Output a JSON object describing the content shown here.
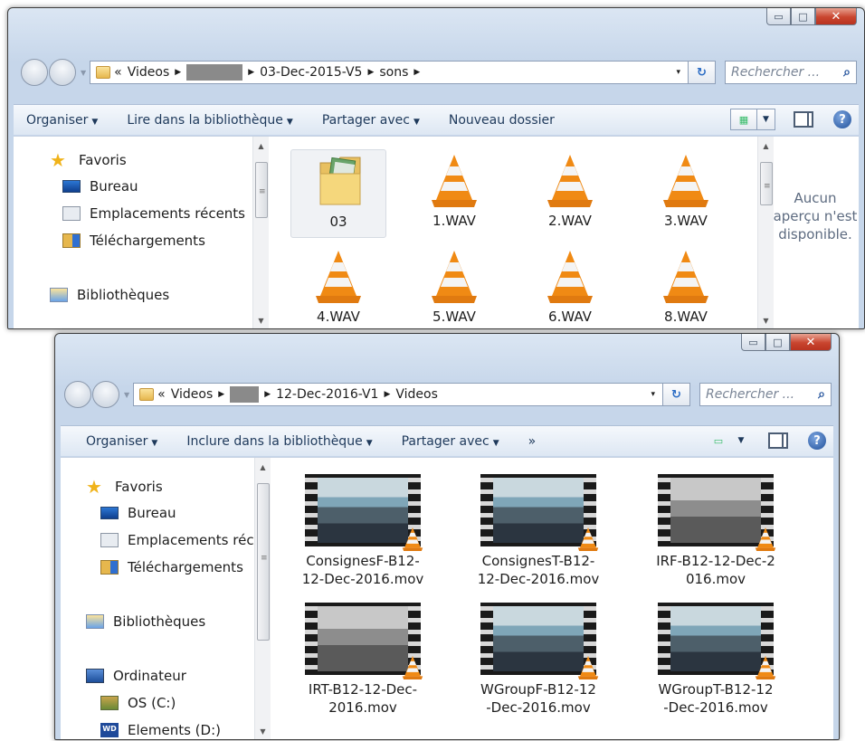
{
  "window1": {
    "caption": {
      "minimize": "▭",
      "maximize": "□",
      "close": "✕"
    },
    "address": {
      "chevron": "«",
      "segments": [
        "Videos",
        "03-Dec-2015-V5",
        "sons"
      ],
      "separator": "▶",
      "dropdown": "▾"
    },
    "search_placeholder": "Rechercher ...",
    "toolbar": {
      "organise": "Organiser",
      "play_library": "Lire dans la bibliothèque",
      "share": "Partager avec",
      "new_folder": "Nouveau dossier"
    },
    "nav": {
      "favorites": "Favoris",
      "desktop": "Bureau",
      "recent": "Emplacements récents",
      "downloads": "Téléchargements",
      "libraries": "Bibliothèques"
    },
    "files": [
      "03",
      "1.WAV",
      "2.WAV",
      "3.WAV",
      "4.WAV",
      "5.WAV",
      "6.WAV",
      "8.WAV"
    ],
    "preview_text": [
      "Aucun",
      "aperçu n'est",
      "disponible."
    ]
  },
  "window2": {
    "caption": {
      "minimize": "▭",
      "maximize": "□",
      "close": "✕"
    },
    "address": {
      "chevron": "«",
      "segments": [
        "Videos",
        "12-Dec-2016-V1",
        "Videos"
      ],
      "separator": "▶",
      "dropdown": "▾"
    },
    "search_placeholder": "Rechercher ...",
    "toolbar": {
      "organise": "Organiser",
      "include_library": "Inclure dans la bibliothèque",
      "share": "Partager avec",
      "more": "»"
    },
    "nav": {
      "favorites": "Favoris",
      "desktop": "Bureau",
      "recent": "Emplacements réc",
      "downloads": "Téléchargements",
      "libraries": "Bibliothèques",
      "computer": "Ordinateur",
      "os_drive": "OS (C:)",
      "elements_drive": "Elements (D:)"
    },
    "files": [
      {
        "line1": "ConsignesF-B12-",
        "line2": "12-Dec-2016.mov",
        "tone": "color"
      },
      {
        "line1": "ConsignesT-B12-",
        "line2": "12-Dec-2016.mov",
        "tone": "color"
      },
      {
        "line1": "IRF-B12-12-Dec-2",
        "line2": "016.mov",
        "tone": "gray"
      },
      {
        "line1": "IRT-B12-12-Dec-",
        "line2": "2016.mov",
        "tone": "gray"
      },
      {
        "line1": "WGroupF-B12-12",
        "line2": "-Dec-2016.mov",
        "tone": "color"
      },
      {
        "line1": "WGroupT-B12-12",
        "line2": "-Dec-2016.mov",
        "tone": "color"
      }
    ]
  },
  "colors": {
    "cone_orange": "#f08a14",
    "cone_white": "#f4f4f4",
    "selection": "#f0f2f5"
  }
}
